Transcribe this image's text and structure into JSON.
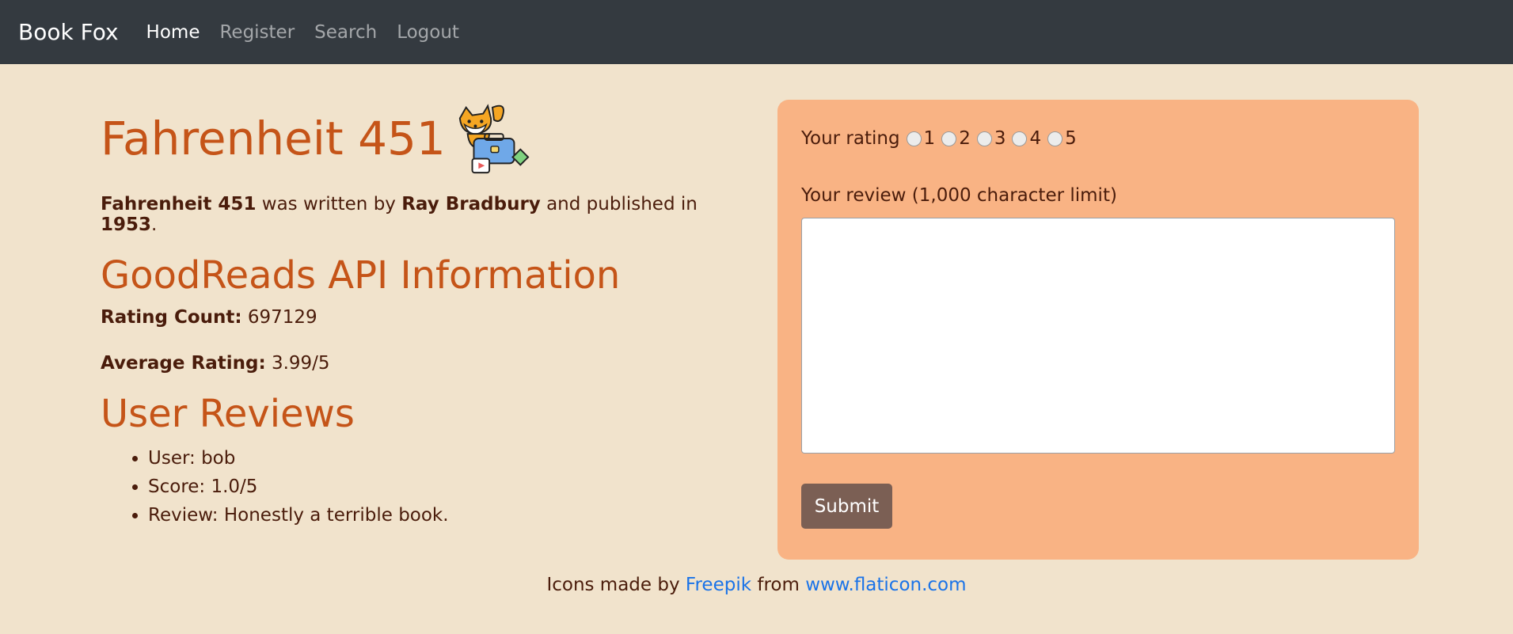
{
  "nav": {
    "brand": "Book Fox",
    "links": [
      "Home",
      "Register",
      "Search",
      "Logout"
    ]
  },
  "book": {
    "title": "Fahrenheit 451",
    "icon": "fox-mascot-icon",
    "summary_title": "Fahrenheit 451",
    "text_was_written_by": " was written by ",
    "author": "Ray Bradbury",
    "text_published_in": " and published in ",
    "year": "1953",
    "period": "."
  },
  "api": {
    "heading": "GoodReads API Information",
    "rating_count_label": "Rating Count:",
    "rating_count_value": "697129",
    "average_rating_label": "Average Rating:",
    "average_rating_value": "3.99/5"
  },
  "reviews": {
    "heading": "User Reviews",
    "items": [
      "User: bob",
      "Score: 1.0/5",
      "Review: Honestly a terrible book."
    ]
  },
  "form": {
    "rating_label": "Your rating",
    "rating_options": [
      "1",
      "2",
      "3",
      "4",
      "5"
    ],
    "review_label": "Your review (1,000 character limit)",
    "review_value": "",
    "submit_label": "Submit"
  },
  "footer": {
    "prefix": "Icons made by ",
    "author_link": "Freepik",
    "middle": " from ",
    "site_link": "www.flaticon.com"
  },
  "colors": {
    "navbar": "#343a40",
    "background": "#f1e3cc",
    "accent": "#c55418",
    "panel": "#f9b384",
    "button": "#7b5f54",
    "link": "#1a73e8"
  }
}
